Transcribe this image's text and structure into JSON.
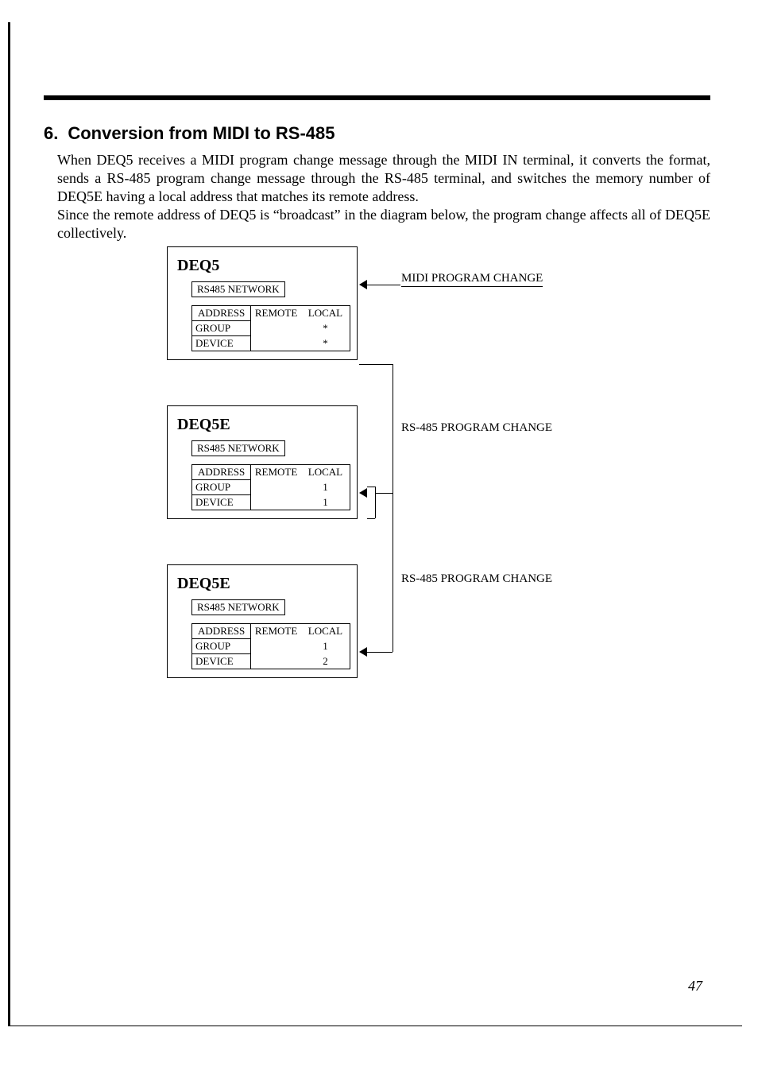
{
  "section": {
    "number": "6.",
    "title": "Conversion from MIDI to RS-485"
  },
  "paragraph1": "When DEQ5 receives a MIDI program change message through the MIDI IN terminal, it converts the format, sends a RS-485 program change message through the RS-485 terminal, and switches the memory number of DEQ5E having a local address that matches its remote address.",
  "paragraph2": "Since the remote address of DEQ5 is “broadcast” in the diagram below, the program change affects all of DEQ5E collectively.",
  "diagram": {
    "midi_label": "MIDI PROGRAM CHANGE",
    "rs485_label": "RS-485 PROGRAM CHANGE",
    "network_label": "RS485 NETWORK",
    "addr_head_label": "ADDRESS",
    "remote_head": "REMOTE",
    "local_head": "LOCAL",
    "row_group": "GROUP",
    "row_device": "DEVICE",
    "nodes": [
      {
        "title": "DEQ5",
        "group_remote": "",
        "group_local": "*",
        "device_remote": "",
        "device_local": "*"
      },
      {
        "title": "DEQ5E",
        "group_remote": "",
        "group_local": "1",
        "device_remote": "",
        "device_local": "1"
      },
      {
        "title": "DEQ5E",
        "group_remote": "",
        "group_local": "1",
        "device_remote": "",
        "device_local": "2"
      }
    ]
  },
  "page_number": "47"
}
